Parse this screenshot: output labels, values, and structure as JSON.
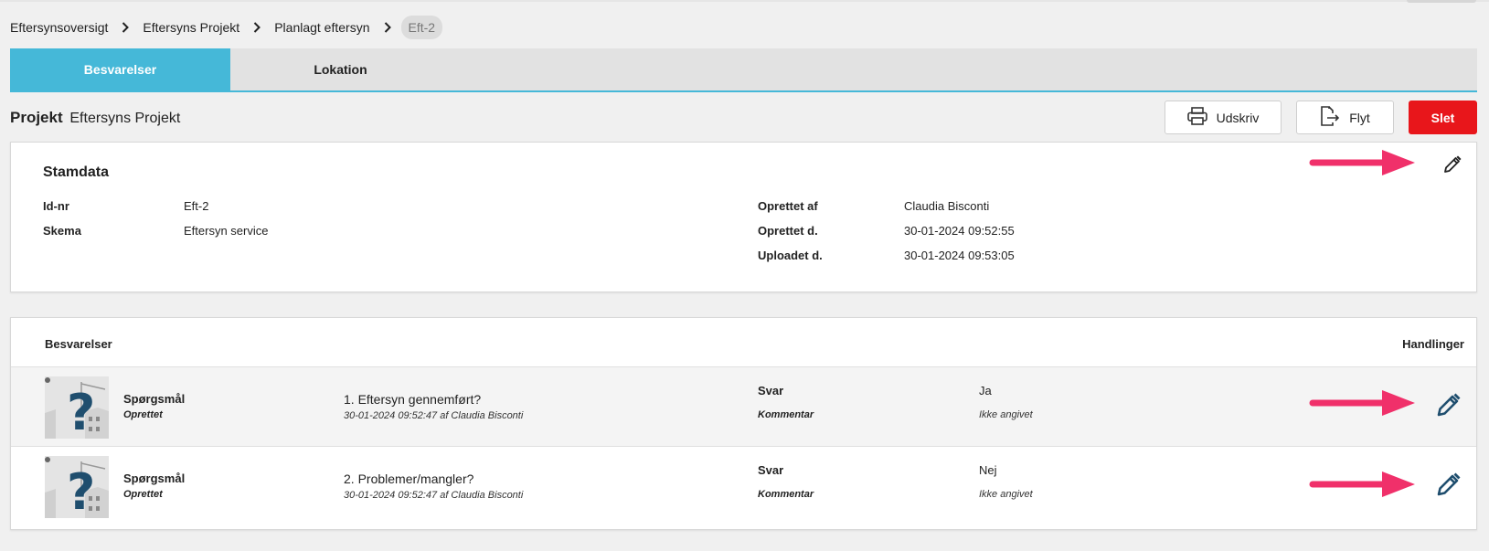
{
  "breadcrumb": {
    "items": [
      "Eftersynsoversigt",
      "Eftersyns Projekt",
      "Planlagt eftersyn"
    ],
    "current": "Eft-2"
  },
  "tabs": [
    {
      "label": "Besvarelser",
      "active": true
    },
    {
      "label": "Lokation",
      "active": false
    }
  ],
  "header": {
    "project_label": "Projekt",
    "project_name": "Eftersyns Projekt"
  },
  "actions": {
    "print_label": "Udskriv",
    "move_label": "Flyt",
    "delete_label": "Slet"
  },
  "stamdata": {
    "title": "Stamdata",
    "left": [
      {
        "key": "Id-nr",
        "value": "Eft-2"
      },
      {
        "key": "Skema",
        "value": "Eftersyn service"
      }
    ],
    "right": [
      {
        "key": "Oprettet af",
        "value": "Claudia Bisconti"
      },
      {
        "key": "Oprettet d.",
        "value": "30-01-2024 09:52:55"
      },
      {
        "key": "Uploadet d.",
        "value": "30-01-2024 09:53:05"
      }
    ]
  },
  "besvarelser": {
    "header_left": "Besvarelser",
    "header_right": "Handlinger",
    "rows": [
      {
        "type": "Spørgsmål",
        "status": "Oprettet",
        "question": "1. Eftersyn gennemført?",
        "meta": "30-01-2024 09:52:47 af Claudia Bisconti",
        "svar_label": "Svar",
        "svar_value": "Ja",
        "kommentar_label": "Kommentar",
        "kommentar_value": "Ikke angivet"
      },
      {
        "type": "Spørgsmål",
        "status": "Oprettet",
        "question": "2. Problemer/mangler?",
        "meta": "30-01-2024 09:52:47 af Claudia Bisconti",
        "svar_label": "Svar",
        "svar_value": "Nej",
        "kommentar_label": "Kommentar",
        "kommentar_value": "Ikke angivet"
      }
    ]
  },
  "icons": {
    "separator": "chevron-right-icon",
    "print": "printer-icon",
    "move": "move-file-icon",
    "edit": "pencil-icon",
    "thumbnail": "question-mark-image",
    "annotation": "arrow-right-icon"
  },
  "colors": {
    "accent": "#45b8d8",
    "danger": "#e8161b",
    "annotation_arrow": "#f0306a",
    "edit_icon_blue": "#1f4e6e"
  }
}
